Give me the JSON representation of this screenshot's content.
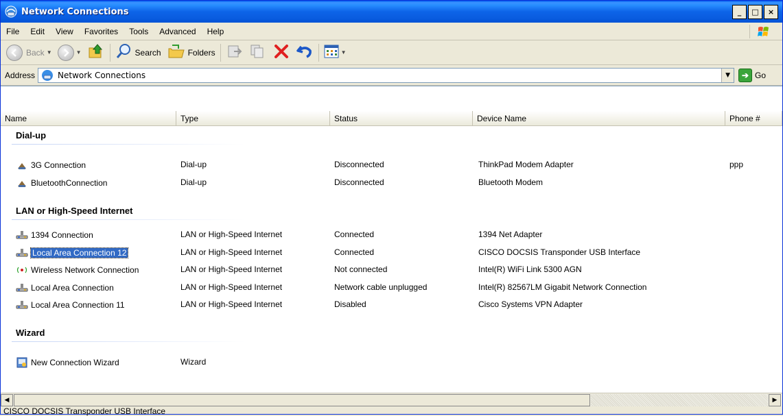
{
  "window": {
    "title": "Network Connections",
    "icon": "network-connections-icon",
    "controls": [
      "_",
      "□",
      "×"
    ]
  },
  "menu": {
    "items": [
      "File",
      "Edit",
      "View",
      "Favorites",
      "Tools",
      "Advanced",
      "Help"
    ]
  },
  "toolbar": {
    "back_label": "Back",
    "search_label": "Search",
    "folders_label": "Folders"
  },
  "address": {
    "label": "Address",
    "value": "Network Connections",
    "go_label": "Go"
  },
  "columns": [
    "Name",
    "Type",
    "Status",
    "Device Name",
    "Phone #"
  ],
  "groups": [
    {
      "label": "Dial-up",
      "rows": [
        {
          "name": "3G Connection",
          "type": "Dial-up",
          "status": "Disconnected",
          "device": "ThinkPad Modem Adapter",
          "phone": "ppp",
          "icon": "dialup-icon"
        },
        {
          "name": "BluetoothConnection",
          "type": "Dial-up",
          "status": "Disconnected",
          "device": "Bluetooth Modem",
          "phone": "",
          "icon": "dialup-icon"
        }
      ]
    },
    {
      "label": "LAN or High-Speed Internet",
      "rows": [
        {
          "name": "1394 Connection",
          "type": "LAN or High-Speed Internet",
          "status": "Connected",
          "device": "1394 Net Adapter",
          "phone": "",
          "icon": "lan-icon"
        },
        {
          "name": "Local Area Connection 12",
          "type": "LAN or High-Speed Internet",
          "status": "Connected",
          "device": "CISCO DOCSIS Transponder USB Interface",
          "phone": "",
          "icon": "lan-icon",
          "selected": true
        },
        {
          "name": "Wireless Network Connection",
          "type": "LAN or High-Speed Internet",
          "status": "Not connected",
          "device": "Intel(R) WiFi Link 5300 AGN",
          "phone": "",
          "icon": "wireless-icon"
        },
        {
          "name": "Local Area Connection",
          "type": "LAN or High-Speed Internet",
          "status": "Network cable unplugged",
          "device": "Intel(R) 82567LM Gigabit Network Connection",
          "phone": "",
          "icon": "lan-icon"
        },
        {
          "name": "Local Area Connection 11",
          "type": "LAN or High-Speed Internet",
          "status": "Disabled",
          "device": "Cisco Systems VPN Adapter",
          "phone": "",
          "icon": "lan-icon"
        }
      ]
    },
    {
      "label": "Wizard",
      "rows": [
        {
          "name": "New Connection Wizard",
          "type": "Wizard",
          "status": "",
          "device": "",
          "phone": "",
          "icon": "wizard-icon"
        }
      ]
    }
  ],
  "statusbar": {
    "text": "CISCO DOCSIS Transponder USB Interface"
  },
  "colors": {
    "selection": "#316ac5",
    "titlebar": "#0a5cdf"
  }
}
